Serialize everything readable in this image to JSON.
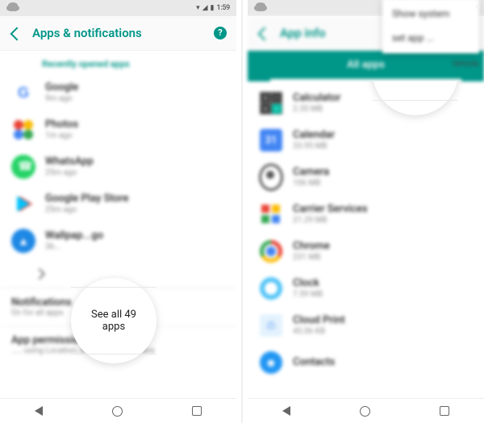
{
  "status": {
    "time": "1:59"
  },
  "left": {
    "header_title": "Apps & notifications",
    "subhead": "Recently opened apps",
    "items": [
      {
        "title": "Google",
        "sub": "9m ago"
      },
      {
        "title": "Photos",
        "sub": "1m ago"
      },
      {
        "title": "WhatsApp",
        "sub": "25m ago"
      },
      {
        "title": "Google Play Store",
        "sub": "25m ago"
      },
      {
        "title": "Wallpap...go",
        "sub": "36..."
      }
    ],
    "see_all": "See all 49 apps",
    "foot": [
      {
        "title": "Notifications",
        "sub": "On for all apps"
      },
      {
        "title": "App permissions",
        "sub": "..... using Location, Microphone, Camera"
      }
    ]
  },
  "right": {
    "header_title": "App info",
    "tab_label": "All apps",
    "menu": {
      "show_system": "Show system",
      "reset": "set app ..."
    },
    "menu_below": "rences",
    "items": [
      {
        "title": "Calculator",
        "sub": "2.35 MB"
      },
      {
        "title": "Calendar",
        "sub": "33.95 MB"
      },
      {
        "title": "Camera",
        "sub": "106 MB"
      },
      {
        "title": "Carrier Services",
        "sub": "21.29 MB"
      },
      {
        "title": "Chrome",
        "sub": "231 MB"
      },
      {
        "title": "Clock",
        "sub": "7.59 MB"
      },
      {
        "title": "Cloud Print",
        "sub": "45.06 KB"
      },
      {
        "title": "Contacts",
        "sub": ""
      }
    ]
  }
}
